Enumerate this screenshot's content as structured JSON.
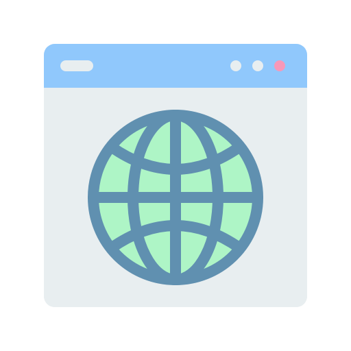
{
  "window": {
    "frame_color": "#e8eef0",
    "titlebar_color": "#90c8fc",
    "address_pill_color": "#e8eef0",
    "controls": [
      {
        "icon": "window-dot-icon",
        "color": "#e8eef0"
      },
      {
        "icon": "window-dot-icon",
        "color": "#e8eef0"
      },
      {
        "icon": "close-dot-icon",
        "color": "#f898b8"
      }
    ]
  },
  "globe": {
    "icon": "globe-icon",
    "fill_color": "#aef5c6",
    "stroke_color": "#6090b0"
  }
}
